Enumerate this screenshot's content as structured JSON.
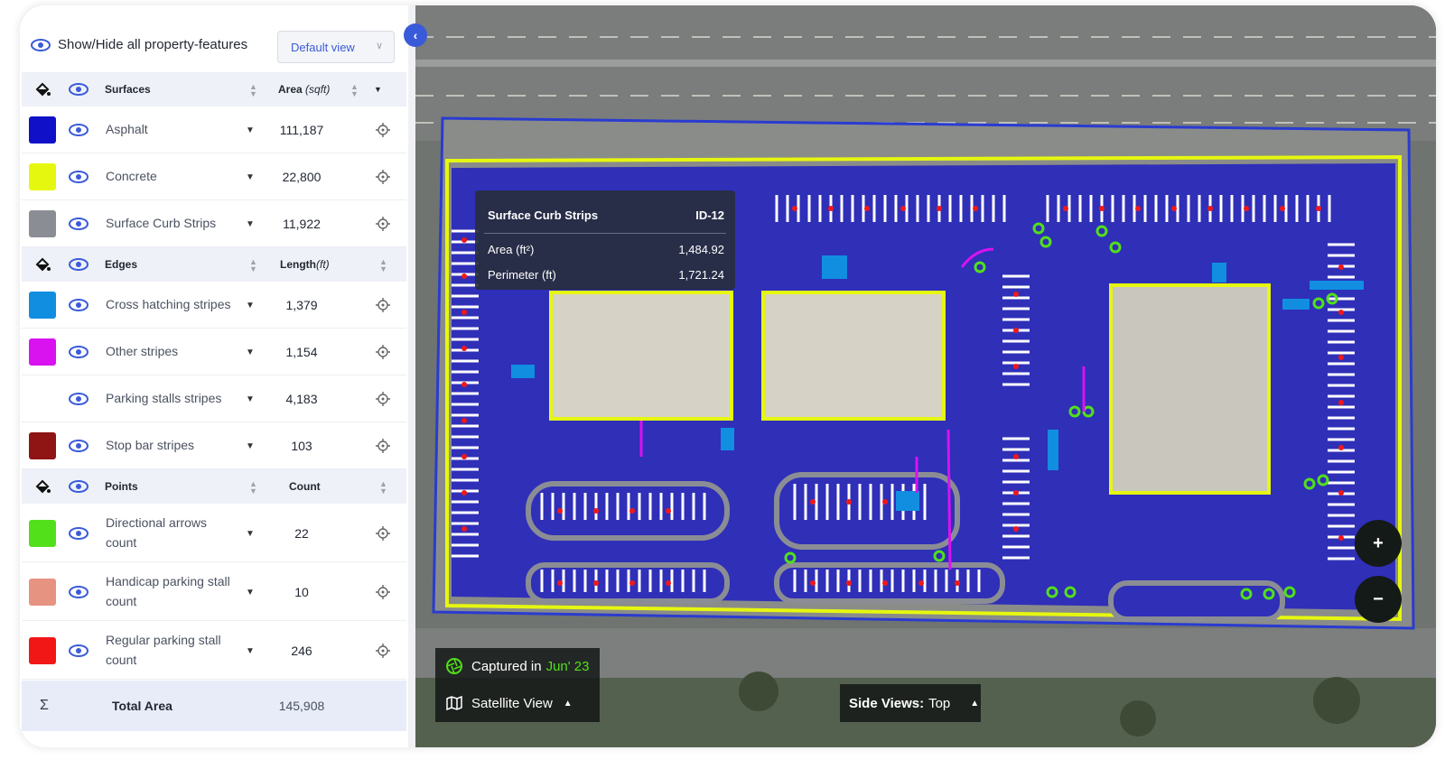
{
  "panel": {
    "show_hide_label": "Show/Hide all property-features",
    "view_select": "Default view"
  },
  "surfaces": {
    "header": "Surfaces",
    "metric": "Area",
    "unit": "(sqft)",
    "items": [
      {
        "label": "Asphalt",
        "value": "111,187",
        "color": "#1010c8"
      },
      {
        "label": "Concrete",
        "value": "22,800",
        "color": "#e6f70f"
      },
      {
        "label": "Surface Curb Strips",
        "value": "11,922",
        "color": "#8b8d94"
      }
    ]
  },
  "edges": {
    "header": "Edges",
    "metric": "Length",
    "unit": "(ft)",
    "items": [
      {
        "label": "Cross hatching stripes",
        "value": "1,379",
        "color": "#118ee0"
      },
      {
        "label": "Other stripes",
        "value": "1,154",
        "color": "#d912f0"
      },
      {
        "label": "Parking stalls stripes",
        "value": "4,183",
        "color": ""
      },
      {
        "label": "Stop bar stripes",
        "value": "103",
        "color": "#8f1414"
      }
    ]
  },
  "points": {
    "header": "Points",
    "metric": "Count",
    "items": [
      {
        "label": "Directional arrows count",
        "value": "22",
        "color": "#52e01a"
      },
      {
        "label": "Handicap parking stall count",
        "value": "10",
        "color": "#e79382"
      },
      {
        "label": "Regular parking stall count",
        "value": "246",
        "color": "#f21717"
      }
    ]
  },
  "total": {
    "symbol": "Σ",
    "label": "Total Area",
    "value": "145,908"
  },
  "tooltip": {
    "title": "Surface Curb Strips",
    "id": "ID-12",
    "area_label": "Area (ft²)",
    "area_value": "1,484.92",
    "perimeter_label": "Perimeter (ft)",
    "perimeter_value": "1,721.24"
  },
  "map": {
    "captured_label": "Captured in",
    "captured_date": "Jun' 23",
    "view_label": "Satellite View",
    "side_views_label": "Side Views:",
    "side_views_value": "Top",
    "zoom_in": "+",
    "zoom_out": "−"
  }
}
